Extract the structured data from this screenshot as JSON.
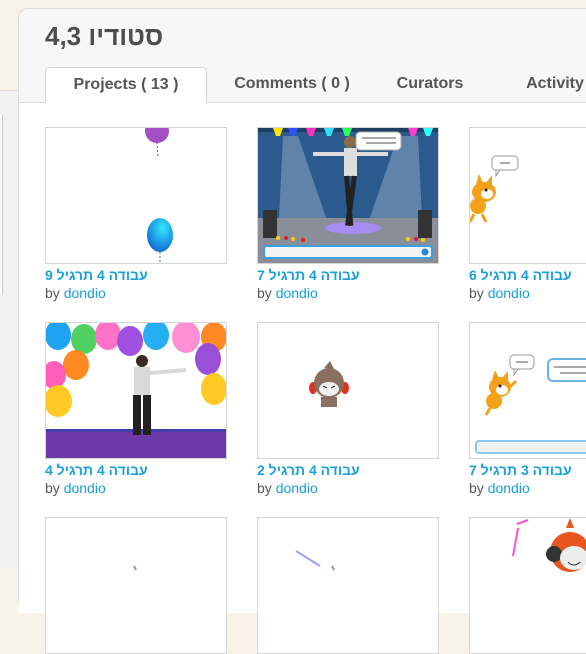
{
  "studio": {
    "title": "סטודיו 4,3"
  },
  "tabs": [
    {
      "label": "Projects ( 13 )",
      "active": true
    },
    {
      "label": "Comments ( 0 )",
      "active": false
    },
    {
      "label": "Curators",
      "active": false
    },
    {
      "label": "Activity",
      "active": false
    }
  ],
  "by_label": "by",
  "projects": [
    {
      "title": "עבודה 4 תרגיל 9",
      "author": "dondio",
      "thumb": "balloons-white"
    },
    {
      "title": "עבודה 4 תרגיל 7",
      "author": "dondio",
      "thumb": "stage-dancer"
    },
    {
      "title": "עבודה 4 תרגיל 6",
      "author": "dondio",
      "thumb": "scratch-cat"
    },
    {
      "title": "עבודה 4 תרגיל 4",
      "author": "dondio",
      "thumb": "balloons-party"
    },
    {
      "title": "עבודה 4 תרגיל 2",
      "author": "dondio",
      "thumb": "monkey-sprite"
    },
    {
      "title": "עבודה 3 תרגיל 7",
      "author": "dondio",
      "thumb": "scratch-cat-dialog"
    },
    {
      "title": "",
      "author": "",
      "thumb": "partial-sprite"
    },
    {
      "title": "",
      "author": "",
      "thumb": "partial-lines"
    },
    {
      "title": "",
      "author": "",
      "thumb": "robot-sprite"
    }
  ]
}
